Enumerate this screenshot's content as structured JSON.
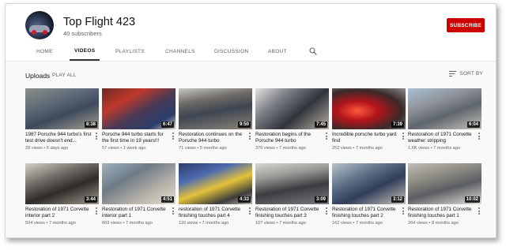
{
  "channel": {
    "name": "Top Flight 423",
    "subscribers": "40 subscribers",
    "subscribe_label": "SUBSCRIBE"
  },
  "tabs": [
    {
      "label": "HOME"
    },
    {
      "label": "VIDEOS"
    },
    {
      "label": "PLAYLISTS"
    },
    {
      "label": "CHANNELS"
    },
    {
      "label": "DISCUSSION"
    },
    {
      "label": "ABOUT"
    }
  ],
  "section": {
    "title": "Uploads",
    "play_all": "PLAY ALL",
    "sort_label": "SORT BY"
  },
  "colors": {
    "accent": "#cc0000",
    "active_tab": "#111111"
  },
  "videos": [
    {
      "title": "1987 Porsche 944 turbo's first test drive doesn't end...",
      "meta": "29 views • 6 days ago",
      "duration": "8:38"
    },
    {
      "title": "Porsche 944 turbo starts for the first time in 19 years!!!",
      "meta": "57 views • 1 week ago",
      "duration": "6:47"
    },
    {
      "title": "Restoration continues on the Porsche 944 turbo",
      "meta": "71 views • 5 months ago",
      "duration": "9:50"
    },
    {
      "title": "Restoration begins of the Porsche 944 turbo",
      "meta": "376 views • 7 months ago",
      "duration": "7:45"
    },
    {
      "title": "Incredible porsche turbo yard find",
      "meta": "252 views • 7 months ago",
      "duration": "7:39"
    },
    {
      "title": "Restoration of 1971 Corvette weather stripping",
      "meta": "1.6K views • 7 months ago",
      "duration": "6:04"
    },
    {
      "title": "Restoration of 1971 Corvette interior part 2",
      "meta": "504 views • 7 months ago",
      "duration": "3:44"
    },
    {
      "title": "Restoration of 1971 Corvette interior part 1",
      "meta": "669 views • 7 months ago",
      "duration": "4:51"
    },
    {
      "title": "restoration of 1971 Corvette finishing touches part 4",
      "meta": "110 views • 7 months ago",
      "duration": "4:33"
    },
    {
      "title": "Restoration of 1971 Corvette finishing touches part 3",
      "meta": "107 views • 7 months ago",
      "duration": "3:09"
    },
    {
      "title": "Restoration of 1971 Corvette finishing touches part 2",
      "meta": "162 views • 7 months ago",
      "duration": "3:12"
    },
    {
      "title": "Restoration of 1971 Corvette finishing touches part 1",
      "meta": "264 views • 8 months ago",
      "duration": "10:02"
    }
  ]
}
